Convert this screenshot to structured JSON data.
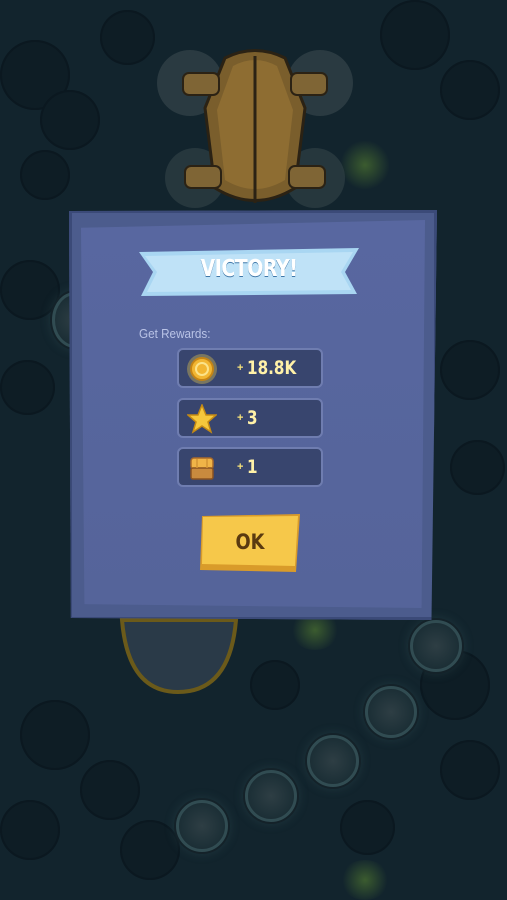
{
  "dialog": {
    "title": "VICTORY!",
    "rewards_label": "Get Rewards:",
    "rewards": [
      {
        "icon": "gold-coin-icon",
        "prefix": "+",
        "value": "18.8K"
      },
      {
        "icon": "star-icon",
        "prefix": "+",
        "value": "3"
      },
      {
        "icon": "treasure-chest-icon",
        "prefix": "+",
        "value": "1"
      }
    ],
    "ok_label": "OK"
  },
  "colors": {
    "dialog_bg": "#55649a",
    "ribbon": "#a9d6f2",
    "button": "#f6c84a",
    "reward_text": "#fff1a8"
  }
}
